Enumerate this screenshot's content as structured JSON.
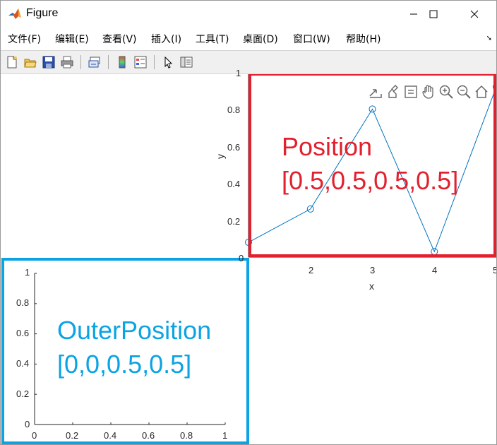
{
  "window": {
    "title": "Figure",
    "app_icon": "matlab-logo",
    "controls": {
      "minimize_icon": "minimize-icon",
      "maximize_icon": "maximize-icon",
      "close_icon": "close-icon"
    }
  },
  "menubar": {
    "items": [
      {
        "label": "文件(F)"
      },
      {
        "label": "编辑(E)"
      },
      {
        "label": "查看(V)"
      },
      {
        "label": "插入(I)"
      },
      {
        "label": "工具(T)"
      },
      {
        "label": "桌面(D)"
      },
      {
        "label": "窗口(W)"
      },
      {
        "label": "帮助(H)"
      }
    ],
    "dock_icon": "dock-arrow-icon",
    "dock_glyph": "➘"
  },
  "toolbar": {
    "items": [
      "new-figure-icon",
      "open-file-icon",
      "save-icon",
      "print-icon",
      "link-plot-icon",
      "insert-colorbar-icon",
      "insert-legend-icon",
      "edit-plot-arrow-icon",
      "property-inspector-icon"
    ]
  },
  "axes_toolbar": {
    "items": [
      "export-icon",
      "brush-icon",
      "data-tips-icon",
      "pan-icon",
      "zoom-in-icon",
      "zoom-out-icon",
      "restore-view-icon"
    ]
  },
  "top_axes": {
    "xlabel": "x",
    "ylabel": "y",
    "yticks": [
      "0",
      "0.2",
      "0.4",
      "0.6",
      "0.8",
      "1"
    ],
    "xticks": [
      "2",
      "3",
      "4",
      "5"
    ],
    "annotation": {
      "line1": "Position",
      "line2": "[0.5,0.5,0.5,0.5]",
      "color": "#e3202d"
    }
  },
  "bottom_axes": {
    "yticks": [
      "0",
      "0.2",
      "0.4",
      "0.6",
      "0.8",
      "1"
    ],
    "xticks": [
      "0",
      "0.2",
      "0.4",
      "0.6",
      "0.8",
      "1"
    ],
    "annotation": {
      "line1": "OuterPosition",
      "line2": "[0,0,0.5,0.5]",
      "color": "#0aa3e3"
    }
  },
  "chart_data": {
    "type": "line",
    "x": [
      1,
      2,
      3,
      4,
      5
    ],
    "y": [
      0.08,
      0.26,
      0.8,
      0.03,
      0.92
    ],
    "marker": "circle",
    "color": "#0072bd",
    "xlim": [
      1,
      5
    ],
    "ylim": [
      0,
      1
    ],
    "xlabel": "x",
    "ylabel": "y"
  }
}
